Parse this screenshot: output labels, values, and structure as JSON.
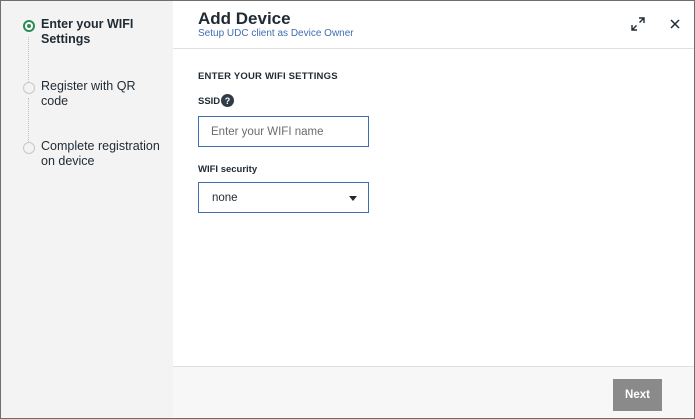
{
  "stepper": {
    "steps": [
      {
        "label": "Enter your WIFI Settings",
        "state": "active"
      },
      {
        "label": "Register with QR code",
        "state": "pending"
      },
      {
        "label": "Complete registration on device",
        "state": "pending"
      }
    ]
  },
  "header": {
    "title": "Add Device",
    "subtitle": "Setup UDC client as Device Owner",
    "expand_icon": "expand-icon",
    "close_icon": "close-icon"
  },
  "form": {
    "section_title": "ENTER YOUR WIFI SETTINGS",
    "ssid_label": "SSID",
    "help_glyph": "?",
    "ssid_placeholder": "Enter your WIFI name",
    "ssid_value": "",
    "security_label": "WIFI security",
    "security_value": "none"
  },
  "footer": {
    "next_label": "Next"
  },
  "colors": {
    "accent": "#3f6eb0",
    "active_step": "#2e8b57",
    "button": "#8a8a8a"
  }
}
